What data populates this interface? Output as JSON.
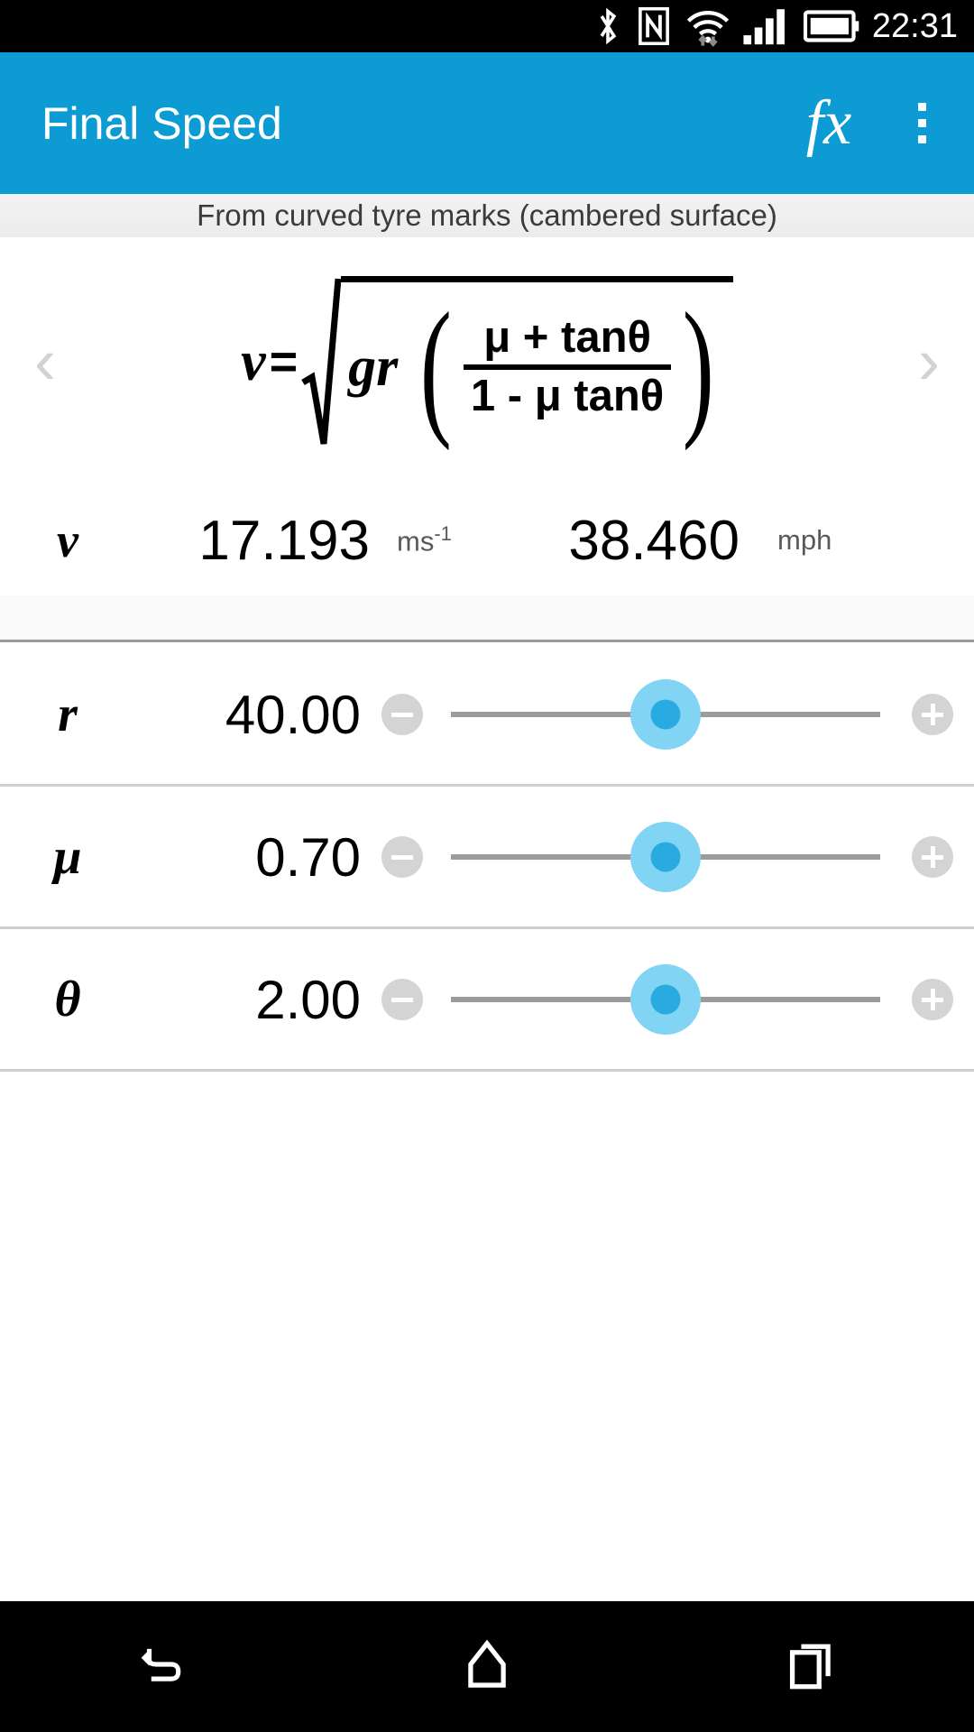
{
  "statusbar": {
    "time": "22:31",
    "icons": [
      "bluetooth-icon",
      "nfc-icon",
      "wifi-icon",
      "cellular-signal-icon",
      "battery-icon"
    ]
  },
  "appbar": {
    "title": "Final Speed",
    "fx_label": "fx",
    "overflow_label": "⋮",
    "background": "#0c9bd2"
  },
  "subtitle": {
    "text": "From curved tyre marks (cambered surface)"
  },
  "nav": {
    "prev": "‹",
    "next": "›"
  },
  "formula": {
    "lhs": "v",
    "equals": "=",
    "radicand_prefix": "gr",
    "paren_open": "(",
    "paren_close": ")",
    "numerator": "μ + tanθ",
    "denominator": "1 - μ tanθ",
    "plain": "v = √( gr ( (μ + tanθ) / (1 - μ tanθ) ) )"
  },
  "result": {
    "symbol": "v",
    "value_si": "17.193",
    "unit_si": "ms",
    "unit_si_exp": "-1",
    "value_imperial": "38.460",
    "unit_imperial": "mph"
  },
  "inputs": [
    {
      "symbol": "r",
      "value": "40.00",
      "minus_label": "−",
      "plus_label": "+",
      "thumb_percent": 50
    },
    {
      "symbol": "μ",
      "value": "0.70",
      "minus_label": "−",
      "plus_label": "+",
      "thumb_percent": 50
    },
    {
      "symbol": "θ",
      "value": "2.00",
      "minus_label": "−",
      "plus_label": "+",
      "thumb_percent": 50
    }
  ],
  "navbar": {
    "back": "back-icon",
    "home": "home-icon",
    "recents": "recents-icon"
  },
  "colors": {
    "accent": "#0c9bd2",
    "thumb": "#29abe2",
    "thumb_halo": "#81d4f3",
    "track": "#9c9c9c",
    "divider": "#cfcfcf"
  }
}
